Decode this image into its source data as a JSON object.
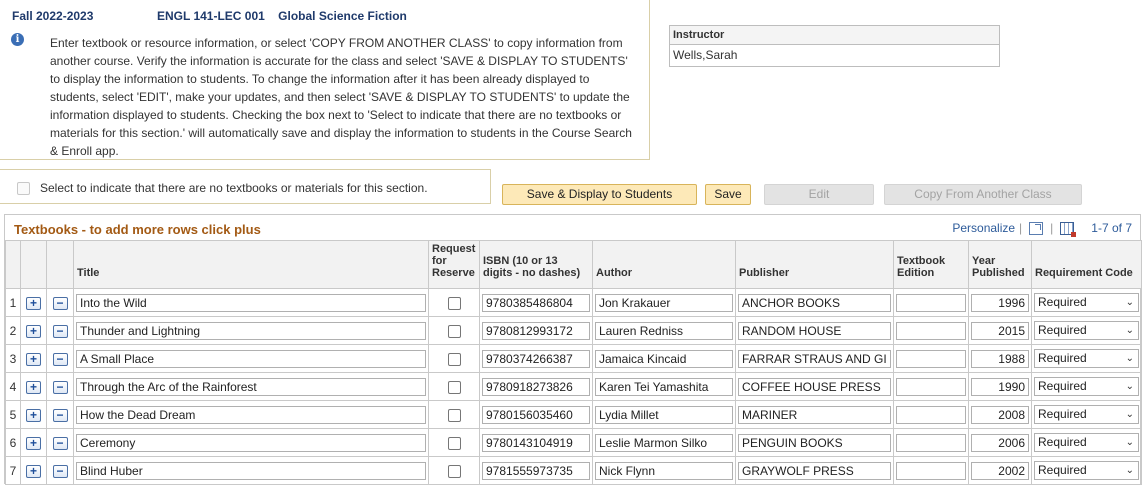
{
  "header": {
    "term": "Fall 2022-2023",
    "course_code": "ENGL  141-LEC 001",
    "course_title": "Global Science Fiction"
  },
  "info": {
    "icon": "info-icon",
    "text": "Enter textbook or resource information, or select 'COPY FROM ANOTHER CLASS' to copy information from another course. Verify the information is accurate for the class and select 'SAVE & DISPLAY TO STUDENTS' to display the information to students. To change the information after it has been already displayed to students, select 'EDIT', make your updates, and then select 'SAVE & DISPLAY TO STUDENTS' to update the information displayed to students. Checking the box next to 'Select to indicate that there are no textbooks or materials for this section.' will automatically save and display the information to students in the Course Search & Enroll app."
  },
  "instructor": {
    "label": "Instructor",
    "value": "Wells,Sarah"
  },
  "no_materials": {
    "label": "Select to indicate that there are no textbooks or materials for this section.",
    "checked": false
  },
  "buttons": {
    "save_display": "Save & Display to Students",
    "save": "Save",
    "edit": "Edit",
    "copy": "Copy From Another Class"
  },
  "grid": {
    "title": "Textbooks - to add more rows click plus",
    "personalize": "Personalize",
    "pager": "1-7 of 7",
    "columns": {
      "title": "Title",
      "request": "Request for Reserve",
      "isbn": "ISBN (10 or 13 digits - no dashes)",
      "author": "Author",
      "publisher": "Publisher",
      "edition": "Textbook Edition",
      "year": "Year Published",
      "requirement": "Requirement Code"
    },
    "add_symbol": "+",
    "remove_symbol": "−",
    "rows": [
      {
        "num": "1",
        "title": "Into the Wild",
        "isbn": "9780385486804",
        "author": "Jon Krakauer",
        "publisher": "ANCHOR BOOKS",
        "edition": "",
        "year": "1996",
        "requirement": "Required"
      },
      {
        "num": "2",
        "title": "Thunder and Lightning",
        "isbn": "9780812993172",
        "author": "Lauren Redniss",
        "publisher": "RANDOM HOUSE",
        "edition": "",
        "year": "2015",
        "requirement": "Required"
      },
      {
        "num": "3",
        "title": "A Small Place",
        "isbn": "9780374266387",
        "author": "Jamaica Kincaid",
        "publisher": "FARRAR STRAUS AND GI",
        "edition": "",
        "year": "1988",
        "requirement": "Required"
      },
      {
        "num": "4",
        "title": "Through the Arc of the Rainforest",
        "isbn": "9780918273826",
        "author": "Karen Tei Yamashita",
        "publisher": "COFFEE HOUSE PRESS",
        "edition": "",
        "year": "1990",
        "requirement": "Required"
      },
      {
        "num": "5",
        "title": "How the Dead Dream",
        "isbn": "9780156035460",
        "author": "Lydia Millet",
        "publisher": "MARINER",
        "edition": "",
        "year": "2008",
        "requirement": "Required"
      },
      {
        "num": "6",
        "title": "Ceremony",
        "isbn": "9780143104919",
        "author": "Leslie Marmon Silko",
        "publisher": "PENGUIN BOOKS",
        "edition": "",
        "year": "2006",
        "requirement": "Required"
      },
      {
        "num": "7",
        "title": "Blind Huber",
        "isbn": "9781555973735",
        "author": "Nick Flynn",
        "publisher": "GRAYWOLF PRESS",
        "edition": "",
        "year": "2002",
        "requirement": "Required"
      }
    ]
  }
}
